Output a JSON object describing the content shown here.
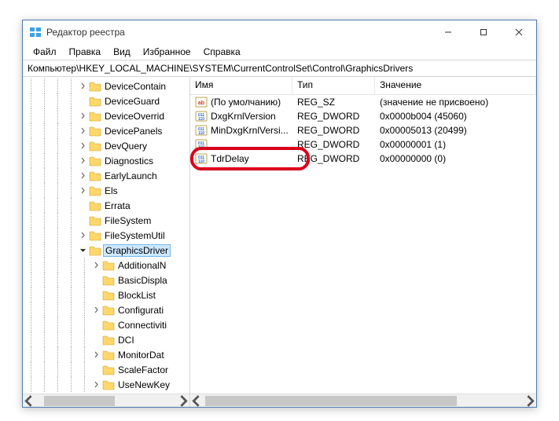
{
  "window": {
    "title": "Редактор реестра"
  },
  "menu": {
    "file": "Файл",
    "edit": "Правка",
    "view": "Вид",
    "favorites": "Избранное",
    "help": "Справка"
  },
  "address": "Компьютер\\HKEY_LOCAL_MACHINE\\SYSTEM\\CurrentControlSet\\Control\\GraphicsDrivers",
  "tree": [
    {
      "label": "DeviceContain",
      "depth": 4,
      "expander": "right"
    },
    {
      "label": "DeviceGuard",
      "depth": 4,
      "expander": "none"
    },
    {
      "label": "DeviceOverrid",
      "depth": 4,
      "expander": "right"
    },
    {
      "label": "DevicePanels",
      "depth": 4,
      "expander": "right"
    },
    {
      "label": "DevQuery",
      "depth": 4,
      "expander": "right"
    },
    {
      "label": "Diagnostics",
      "depth": 4,
      "expander": "right"
    },
    {
      "label": "EarlyLaunch",
      "depth": 4,
      "expander": "right"
    },
    {
      "label": "Els",
      "depth": 4,
      "expander": "right"
    },
    {
      "label": "Errata",
      "depth": 4,
      "expander": "none"
    },
    {
      "label": "FileSystem",
      "depth": 4,
      "expander": "none"
    },
    {
      "label": "FileSystemUtil",
      "depth": 4,
      "expander": "right"
    },
    {
      "label": "GraphicsDriver",
      "depth": 4,
      "expander": "down",
      "selected": true
    },
    {
      "label": "AdditionalN",
      "depth": 5,
      "expander": "right"
    },
    {
      "label": "BasicDispla",
      "depth": 5,
      "expander": "none"
    },
    {
      "label": "BlockList",
      "depth": 5,
      "expander": "none"
    },
    {
      "label": "Configurati",
      "depth": 5,
      "expander": "right"
    },
    {
      "label": "Connectiviti",
      "depth": 5,
      "expander": "none"
    },
    {
      "label": "DCI",
      "depth": 5,
      "expander": "none"
    },
    {
      "label": "MonitorDat",
      "depth": 5,
      "expander": "right"
    },
    {
      "label": "ScaleFactor",
      "depth": 5,
      "expander": "none"
    },
    {
      "label": "UseNewKey",
      "depth": 5,
      "expander": "right"
    }
  ],
  "columns": {
    "name": "Имя",
    "type": "Тип",
    "value": "Значение"
  },
  "values": [
    {
      "icon": "sz",
      "name": "(По умолчанию)",
      "type": "REG_SZ",
      "value": "(значение не присвоено)"
    },
    {
      "icon": "dw",
      "name": "DxgKrnlVersion",
      "type": "REG_DWORD",
      "value": "0x0000b004 (45060)"
    },
    {
      "icon": "dw",
      "name": "MinDxgKrnlVersi...",
      "type": "REG_DWORD",
      "value": "0x00005013 (20499)"
    },
    {
      "icon": "dw",
      "name": "",
      "type": "REG_DWORD",
      "value": "0x00000001 (1)",
      "obscured": true
    },
    {
      "icon": "dw",
      "name": "TdrDelay",
      "type": "REG_DWORD",
      "value": "0x00000000 (0)",
      "highlight": true
    }
  ]
}
